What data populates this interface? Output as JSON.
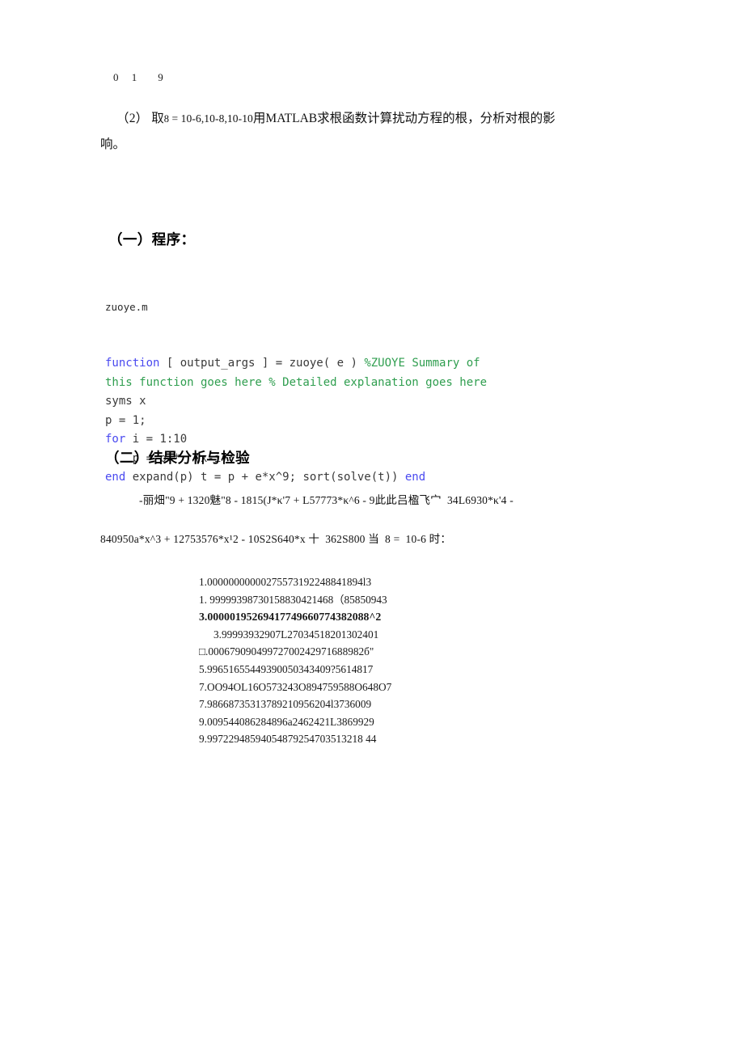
{
  "document": {
    "orphan_superscripts": "0     1        9",
    "problem": {
      "number": "（2）",
      "text_before": "取",
      "epsilon": "8",
      "equals": " = ",
      "values": "10-6,10-8,10-10",
      "text_after": "用MATLAB求根函数计算扰动方程的根，分析",
      "text_after2": "对根的影",
      "continuation": "响。"
    },
    "sections": {
      "program_heading": "（一）程序：",
      "analysis_heading": "（二）结果分析与检验"
    },
    "code": {
      "filename": "zuoye.m",
      "lines": [
        [
          {
            "t": "function",
            "c": "kw"
          },
          {
            "t": " [ output_args ] = zuoye( e ) ",
            "c": "plain"
          },
          {
            "t": "%ZUOYE Summary of",
            "c": "cmt"
          }
        ],
        [
          {
            "t": "this function goes here % Detailed explanation goes here",
            "c": "cmt"
          }
        ],
        [
          {
            "t": "syms x",
            "c": "plain"
          }
        ],
        [
          {
            "t": "p = 1;",
            "c": "plain"
          }
        ],
        [
          {
            "t": "for",
            "c": "kw"
          },
          {
            "t": " i = 1:10",
            "c": "plain"
          }
        ],
        [
          {
            "t": "    p = p *  (x-i);",
            "c": "plain"
          }
        ],
        [
          {
            "t": "end",
            "c": "kw"
          },
          {
            "t": " expand(p) t = p + e*x^9; sort(solve(t)) ",
            "c": "plain"
          },
          {
            "t": "end",
            "c": "kw"
          }
        ]
      ]
    },
    "equation": {
      "line1": "-丽畑\"9 + 1320魅\"8 - 1815(J*κ'7 + L57773*κ^6 - 9此此吕楹飞宀  34L6930*κ'4 -",
      "line2": "840950a*x^3 + 12753576*x¹2 - 10S2S640*x 十  362S800 当  8 =  10-6 时："
    },
    "results": [
      {
        "value": "1.00000000000275573192248841894l3",
        "bold": false,
        "indent": 0
      },
      {
        "value": "1. 99999398730158830421468（85850943",
        "bold": false,
        "indent": 0
      },
      {
        "value": "3.00000195269417749660774382088^2",
        "bold": true,
        "indent": 0
      },
      {
        "value": "3.99993932907L27034518201302401",
        "bold": false,
        "indent": 18
      },
      {
        "value": "□.00067909049972700242971688982б\"",
        "bold": false,
        "indent": 0
      },
      {
        "value": "5.99651655449390050343409?5614817",
        "bold": false,
        "indent": 0
      },
      {
        "value": "7.OO94OL16O573243O894759588O648O7",
        "bold": false,
        "indent": 0
      },
      {
        "value": "7.98668735313789210956204l3736009",
        "bold": false,
        "indent": 0
      },
      {
        "value": "9.009544086284896a2462421L3869929",
        "bold": false,
        "indent": 0
      },
      {
        "value": "9.99722948594054879254703513218 44",
        "bold": false,
        "indent": 0
      }
    ]
  }
}
